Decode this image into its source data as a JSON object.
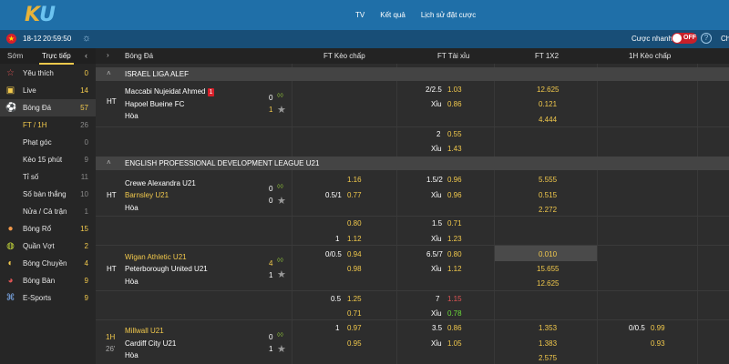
{
  "header": {
    "logo_k": "K",
    "logo_u": "U",
    "nav": [
      "TV",
      "Kết quả",
      "Lịch sử đặt cược"
    ]
  },
  "subbar": {
    "date": "18-12",
    "time": "20:59:50",
    "quick_bet_label": "Cược nhanh",
    "toggle_label": "OFF",
    "help": "?",
    "cut_text": "Ch"
  },
  "sidebar": {
    "tabs": [
      "Sớm",
      "Trực tiếp"
    ],
    "items": [
      {
        "label": "Yêu thích",
        "count": "0"
      },
      {
        "label": "Live",
        "count": "14"
      },
      {
        "label": "Bóng Đá",
        "count": "57"
      },
      {
        "label": "FT / 1H",
        "count": "26"
      },
      {
        "label": "Phạt góc",
        "count": "0"
      },
      {
        "label": "Kèo 15 phút",
        "count": "9"
      },
      {
        "label": "Tỉ số",
        "count": "11"
      },
      {
        "label": "Số bàn thắng",
        "count": "10"
      },
      {
        "label": "Nửa / Cả trận",
        "count": "1"
      },
      {
        "label": "Bóng Rổ",
        "count": "15"
      },
      {
        "label": "Quần Vợt",
        "count": "2"
      },
      {
        "label": "Bóng Chuyền",
        "count": "4"
      },
      {
        "label": "Bóng Bàn",
        "count": "9"
      },
      {
        "label": "E-Sports",
        "count": "9"
      }
    ]
  },
  "columns": {
    "sport": "Bóng Đá",
    "ft_handicap": "FT Kèo chấp",
    "ft_overunder": "FT Tài xỉu",
    "ft_1x2": "FT 1X2",
    "h1_handicap": "1H Kèo chấp"
  },
  "leagues": {
    "l1": "ISRAEL LIGA ALEF",
    "l2": "ENGLISH PROFESSIONAL DEVELOPMENT LEAGUE U21"
  },
  "matches": {
    "m1": {
      "status": "HT",
      "home": "Maccabi Nujeidat Ahmed",
      "red_card": "1",
      "away": "Hapoel Bueine FC",
      "draw": "Hòa",
      "home_score": "0",
      "away_score": "1",
      "ou_line1": "2/2.5",
      "ou_over1": "1.03",
      "ou_under_label": "Xỉu",
      "ou_under1": "0.86",
      "x12_home": "12.625",
      "x12_away": "0.121",
      "x12_draw": "4.444",
      "ou_line2": "2",
      "ou_over2": "0.55",
      "ou_under2": "1.43"
    },
    "m2": {
      "status": "HT",
      "home": "Crewe Alexandra U21",
      "away": "Barnsley U21",
      "draw": "Hòa",
      "home_score": "0",
      "away_score": "0",
      "hcp_home": "1.16",
      "hcp_line": "0.5/1",
      "hcp_away": "0.77",
      "ou_line1": "1.5/2",
      "ou_over1": "0.96",
      "ou_under_label": "Xỉu",
      "ou_under1": "0.96",
      "x12_home": "5.555",
      "x12_away": "0.515",
      "x12_draw": "2.272",
      "hcp_home2": "0.80",
      "ou_line2": "1.5",
      "ou_over2": "0.71",
      "hcp_line3": "1",
      "hcp_away2": "1.12",
      "ou_under2": "1.23"
    },
    "m3": {
      "status": "HT",
      "home": "Wigan Athletic U21",
      "away": "Peterborough United U21",
      "draw": "Hòa",
      "home_score": "4",
      "away_score": "1",
      "hcp_line": "0/0.5",
      "hcp_home": "0.94",
      "hcp_away": "0.98",
      "ou_line1": "6.5/7",
      "ou_over1": "0.80",
      "ou_under_label": "Xỉu",
      "ou_under1": "1.12",
      "x12_home": "0.010",
      "x12_away": "15.655",
      "x12_draw": "12.625",
      "hcp_line2": "0.5",
      "hcp_home2": "1.25",
      "ou_line2": "7",
      "ou_over2": "1.15",
      "hcp_away2": "0.71",
      "ou_under2": "0.78"
    },
    "m4": {
      "status": "1H",
      "minute": "26'",
      "home": "Millwall U21",
      "away": "Cardiff City U21",
      "draw": "Hòa",
      "home_score": "0",
      "away_score": "1",
      "hcp_line": "1",
      "hcp_home": "0.97",
      "hcp_away": "0.95",
      "ou_line1": "3.5",
      "ou_over1": "0.86",
      "ou_under_label": "Xỉu",
      "ou_under1": "1.05",
      "x12_home": "1.353",
      "x12_away": "1.383",
      "x12_draw": "2.575",
      "h1_line": "0/0.5",
      "h1_home": "0.99",
      "h1_away": "0.93"
    }
  },
  "colors": {
    "header_bg": "#1f6fa8",
    "subbar_bg": "#184e77",
    "accent_yellow": "#f2c94c",
    "red": "#d8202a",
    "green": "#6cdc3a"
  }
}
